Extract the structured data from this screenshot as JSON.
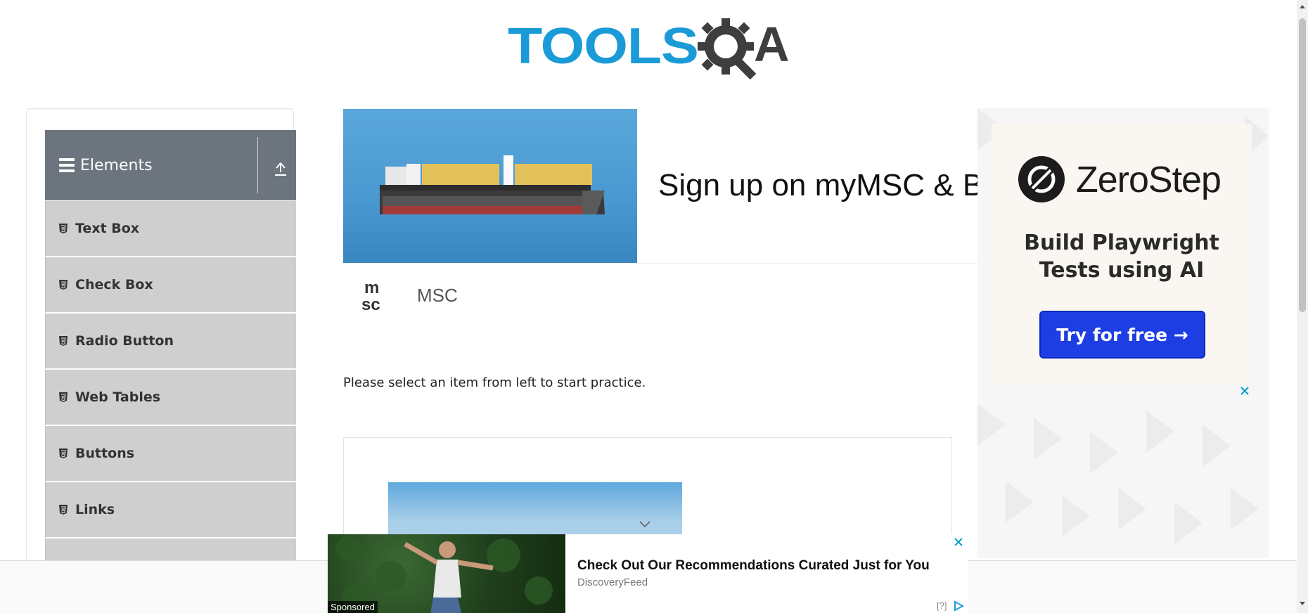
{
  "logo": {
    "text_left": "TOOLS",
    "text_right": "A"
  },
  "sidebar": {
    "group_title": "Elements",
    "items": [
      {
        "label": "Text Box"
      },
      {
        "label": "Check Box"
      },
      {
        "label": "Radio Button"
      },
      {
        "label": "Web Tables"
      },
      {
        "label": "Buttons"
      },
      {
        "label": "Links"
      }
    ]
  },
  "main_ad": {
    "headline": "Sign up on myMSC & B",
    "brand": "MSC"
  },
  "main": {
    "practice_text": "Please select an item from left to start practice."
  },
  "right_ad": {
    "brand": "ZeroStep",
    "tagline_line1": "Build Playwright",
    "tagline_line2": "Tests using AI",
    "cta": "Try for free →",
    "close": "✕"
  },
  "bottom_ad": {
    "sponsored": "Sponsored",
    "title": "Check Out Our Recommendations Curated Just for You",
    "source": "DiscoveryFeed",
    "help": "[?]",
    "close": "✕"
  },
  "colors": {
    "sidebar_header": "#6c757d",
    "menu_item": "#cfcfcf",
    "logo_blue": "#1a9bd7",
    "cta_blue": "#1d3ee3"
  }
}
